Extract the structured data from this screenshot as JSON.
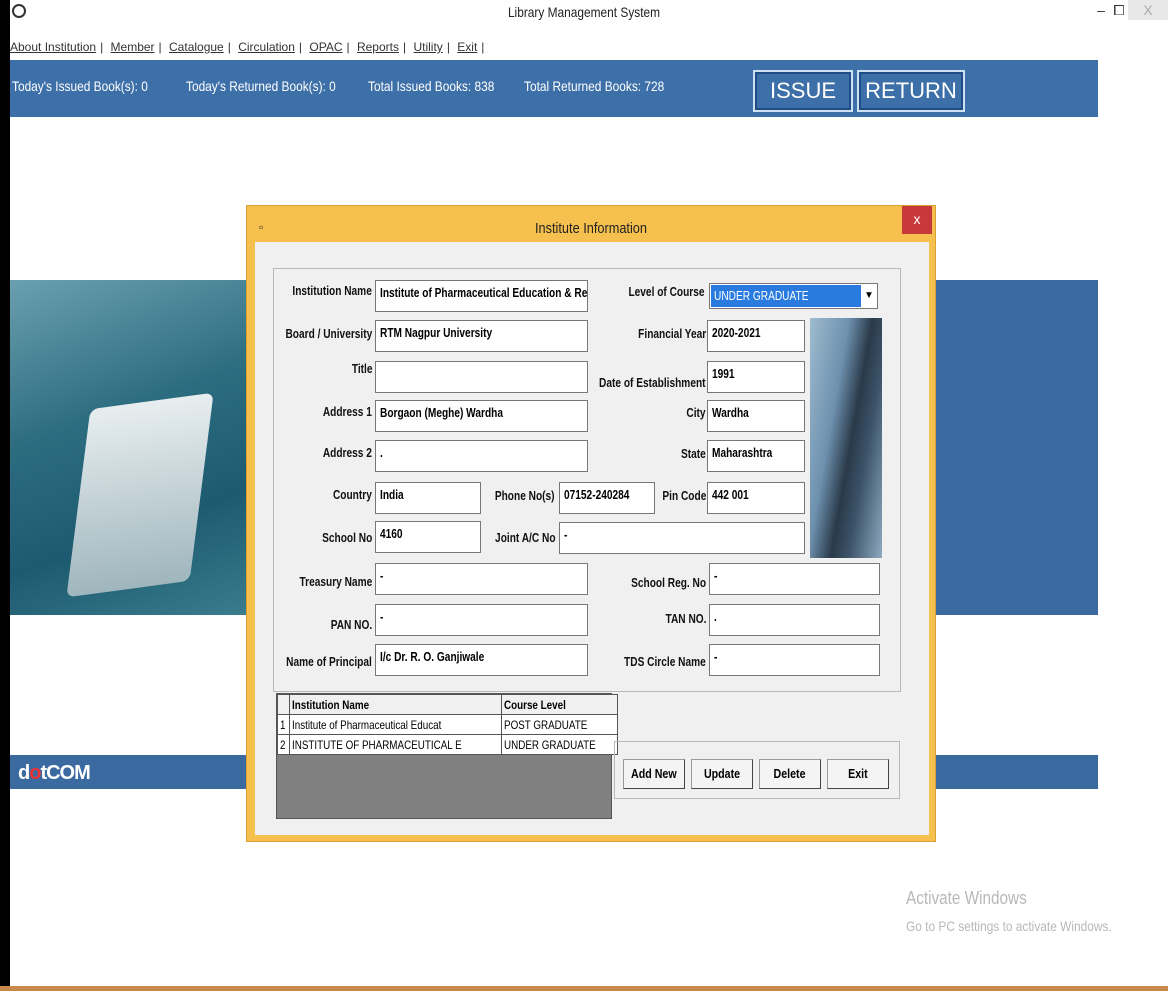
{
  "window": {
    "title": "Library Management System",
    "minimize": "–",
    "maximize": "⧠",
    "close": "X"
  },
  "menu": {
    "items": [
      "About Institution",
      "Member",
      "Catalogue",
      "Circulation",
      "OPAC",
      "Reports",
      "Utility",
      "Exit"
    ]
  },
  "status": {
    "todays_issued": "Today's Issued Book(s): 0",
    "todays_returned": "Today's Returned Book(s): 0",
    "total_issued": "Total Issued Books: 838",
    "total_returned": "Total Returned Books: 728",
    "issue_button": "ISSUE",
    "return_button": "RETURN"
  },
  "brand": {
    "pre": "d",
    "dot": "o",
    "post": "tCOM"
  },
  "dialog": {
    "title": "Institute Information",
    "close": "x",
    "labels": {
      "institution_name": "Institution Name",
      "board": "Board / University",
      "title": "Title",
      "address1": "Address 1",
      "address2": "Address 2",
      "country": "Country",
      "school_no": "School No",
      "treasury": "Treasury Name",
      "pan": "PAN NO.",
      "principal": "Name of Principal",
      "level": "Level of Course",
      "financial_year": "Financial Year",
      "date_est": "Date of Establishment",
      "city": "City",
      "state": "State",
      "pin": "Pin Code",
      "phone": "Phone No(s)",
      "joint_ac": "Joint A/C No",
      "school_reg": "School Reg. No",
      "tan": "TAN NO.",
      "tds": "TDS Circle Name"
    },
    "values": {
      "institution_name": "Institute of Pharmaceutical Education & Res",
      "board": "RTM Nagpur University",
      "title": "",
      "address1": "Borgaon (Meghe) Wardha",
      "address2": ".",
      "country": "India",
      "school_no": "4160",
      "treasury": "-",
      "pan": "-",
      "principal": "I/c Dr. R. O. Ganjiwale",
      "level": "UNDER GRADUATE",
      "financial_year": "2020-2021",
      "date_est": "1991",
      "city": "Wardha",
      "state": "Maharashtra",
      "pin": "442 001",
      "phone": "07152-240284",
      "joint_ac": "-",
      "school_reg": "-",
      "tan": ".",
      "tds": "-"
    },
    "grid": {
      "headers": [
        "Institution Name",
        "Course Level"
      ],
      "rows": [
        {
          "num": "1",
          "name": "Institute of Pharmaceutical Educat",
          "level": "POST GRADUATE"
        },
        {
          "num": "2",
          "name": "INSTITUTE OF PHARMACEUTICAL E",
          "level": "UNDER GRADUATE"
        }
      ]
    },
    "buttons": {
      "add_new": "Add New",
      "update": "Update",
      "delete": "Delete",
      "exit": "Exit"
    }
  },
  "watermark": {
    "line1": "Activate Windows",
    "line2": "Go to PC settings to activate Windows."
  }
}
